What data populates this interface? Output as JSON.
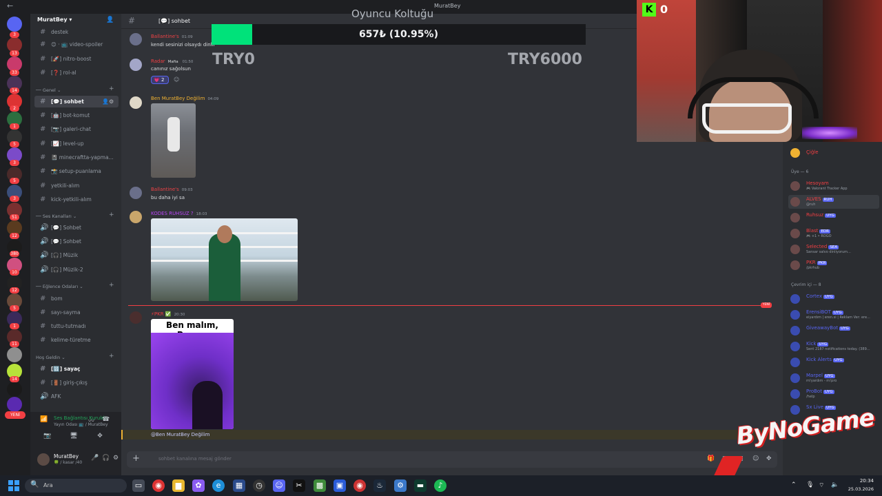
{
  "window": {
    "title": "MuratBey",
    "back": "←"
  },
  "server": {
    "name": "MuratBey",
    "yeni_badge": "YENİ"
  },
  "server_badges": [
    "3",
    "13",
    "33",
    "14",
    "2",
    "1",
    "5",
    "3",
    "5",
    "3",
    "51",
    "12",
    "380",
    "10",
    "12",
    "5",
    "1",
    "11",
    "14"
  ],
  "channels": {
    "top_items": [
      {
        "label": "destek"
      },
      {
        "label": "😊 · 📺 video-spoiler"
      },
      {
        "label": "[🚀] nitro-boost"
      },
      {
        "label": "[❓] rol-al"
      }
    ],
    "cat_genel": "Genel",
    "genel_items": [
      {
        "label": "[💬] sohbet",
        "active": true
      },
      {
        "label": "[🤖] bot-komut"
      },
      {
        "label": "[📷] galeri-chat"
      },
      {
        "label": "[📈] level-up"
      },
      {
        "label": "📓 minecraftta-yapma..."
      },
      {
        "label": "📸 setup-puanlama"
      },
      {
        "label": "yetkili-alım"
      },
      {
        "label": "kick-yetkili-alım"
      }
    ],
    "cat_ses": "Ses Kanalları",
    "ses_items": [
      {
        "label": "[💬] Sohbet"
      },
      {
        "label": "[💬] Sohbet"
      },
      {
        "label": "[🎧] Müzik"
      },
      {
        "label": "[🎧] Müzik-2"
      }
    ],
    "cat_eglence": "Eğlence Odaları",
    "eglence_items": [
      {
        "label": "bom"
      },
      {
        "label": "sayı-sayma"
      },
      {
        "label": "tuttu-tutmadı"
      },
      {
        "label": "kelime-türetme"
      }
    ],
    "cat_hosgeldin": "Hoş Geldin",
    "hosgeldin_items": [
      {
        "label": "[🔢] sayaç"
      },
      {
        "label": "[🚪] giriş-çıkış"
      },
      {
        "label": "AFK"
      }
    ]
  },
  "voice": {
    "status": "Ses Bağlantısı Kuruldu",
    "sub": "Yayın Odası 📺 / MuratBey"
  },
  "user": {
    "name": "MuratBey",
    "status": "🍀 / kasar /40"
  },
  "chat_header": {
    "channel": "[💬] sohbet"
  },
  "overlay": {
    "title": "Oyuncu Koltuğu",
    "progress_text": "657₺ (10.95%)",
    "progress_fraction": 0.1095,
    "min": "TRY0",
    "max": "TRY6000",
    "fill_color": "#00e27a"
  },
  "messages": [
    {
      "author": "Ballantine's",
      "time": "01:09",
      "text": "kendi sesinizi olsaydı dinlir",
      "color": "#ed4245"
    },
    {
      "author": "Radar",
      "tag": "Mafia",
      "time": "01:50",
      "text": "canınız sağolsun",
      "color": "#f23f43",
      "reaction": "💗 2"
    },
    {
      "author": "Ben MuratBey Değilim",
      "time": "04:09",
      "color": "#f0b232"
    },
    {
      "author": "Ballantine's",
      "time": "09:03",
      "text": "bu daha iyi sa",
      "color": "#ed4245"
    },
    {
      "author": "KODES RUHSUZ ?",
      "time": "18:03",
      "color": "#b845f5"
    },
    {
      "author": "PKR",
      "time": "20:30",
      "color": "#f23f43",
      "caption": "Ben malım, Porno."
    }
  ],
  "new_marker": "YENİ",
  "reply_mention": "@Ben MuratBey Değilim",
  "composer": {
    "placeholder": "sohbet kanalına mesaj gönder"
  },
  "members": {
    "top_name": "Çiğle",
    "cat_uye": "Üye — 6",
    "uye": [
      {
        "name": "Hesoyam",
        "sub": "🎮 Valorant Tracker App",
        "color": "#f23f43"
      },
      {
        "name": "ALVES",
        "tag": "RUH",
        "sub": "@ruh",
        "color": "#f23f43",
        "hover": true
      },
      {
        "name": "Ruhsuz",
        "tag": "UYG",
        "sub": "",
        "color": "#f23f43"
      },
      {
        "name": "Blast",
        "tag": "EDR",
        "sub": "🎮 +1 • ROGO",
        "color": "#f23f43"
      },
      {
        "name": "Selected",
        "tag": "SEA",
        "sub": "Sansar salvo dinliyorum...",
        "color": "#f23f43"
      },
      {
        "name": "PKR",
        "tag": "PKR",
        "sub": "/pkrhub",
        "color": "#f23f43"
      }
    ],
    "cat_cevrim": "Çevrim içi — 8",
    "cevrim": [
      {
        "name": "Cortex",
        "tag": "UYG",
        "sub": "",
        "color": "#5865f2"
      },
      {
        "name": "ErensiBOT",
        "tag": "UYG",
        "sub": "eiyardım | eren.si | Reklam Ver: ere...",
        "color": "#5865f2"
      },
      {
        "name": "GiveawayBot",
        "tag": "UYG",
        "sub": "",
        "color": "#5865f2"
      },
      {
        "name": "Kick",
        "tag": "UYG",
        "sub": "Sent 2187 notifications today. (389...",
        "color": "#5865f2"
      },
      {
        "name": "Kick Alerts",
        "tag": "UYG",
        "sub": "",
        "color": "#5865f2"
      },
      {
        "name": "Marpel",
        "tag": "UYG",
        "sub": "m!yardım - m!pro",
        "color": "#5865f2"
      },
      {
        "name": "ProBot",
        "tag": "UYG",
        "sub": "/help",
        "color": "#5865f2"
      },
      {
        "name": "Sx Live",
        "tag": "UYG",
        "sub": "",
        "color": "#5865f2"
      }
    ]
  },
  "stream": {
    "kick_count": "0",
    "watermark": "ByNoGame"
  },
  "taskbar": {
    "search_placeholder": "Ara",
    "time": "20:34",
    "date": "25.03.2026"
  }
}
